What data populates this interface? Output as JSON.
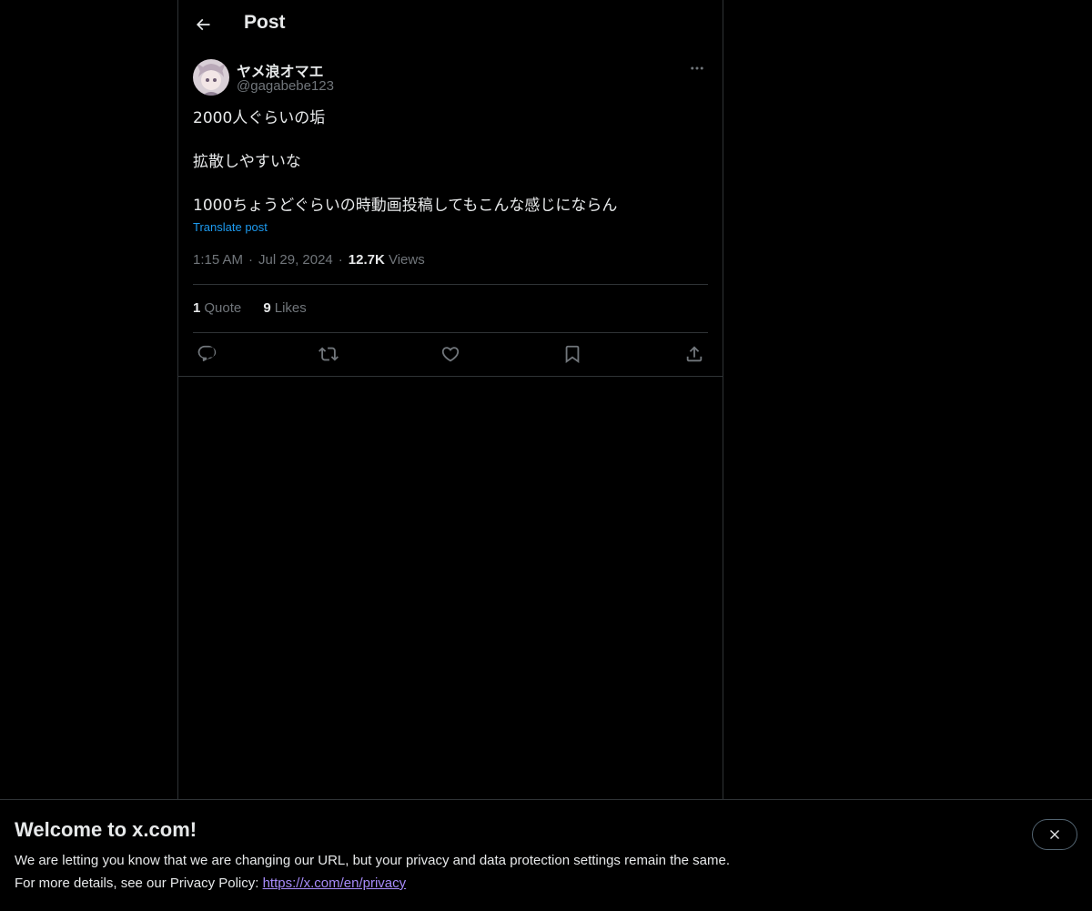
{
  "header": {
    "title": "Post",
    "back_icon": "arrow-left-icon"
  },
  "author": {
    "display_name": "ヤメ浪オマエ",
    "handle": "@gagabebe123",
    "more_icon": "more-horizontal-icon"
  },
  "tweet": {
    "text": "2000人ぐらいの垢\n\n拡散しやすいな\n\n1000ちょうどぐらいの時動画投稿してもこんな感じにならん",
    "translate_label": "Translate post",
    "time": "1:15 AM",
    "date": "Jul 29, 2024",
    "views_count": "12.7K",
    "views_label": "Views",
    "separator": "·"
  },
  "stats": {
    "quotes_count": "1",
    "quotes_label": "Quote",
    "likes_count": "9",
    "likes_label": "Likes"
  },
  "actions": [
    {
      "name": "reply-icon"
    },
    {
      "name": "retweet-icon"
    },
    {
      "name": "like-icon"
    },
    {
      "name": "bookmark-icon"
    },
    {
      "name": "share-icon"
    }
  ],
  "banner": {
    "title": "Welcome to x.com!",
    "line1": "We are letting you know that we are changing our URL, but your privacy and data protection settings remain the same.",
    "line2_prefix": "For more details, see our Privacy Policy: ",
    "link_text": "https://x.com/en/privacy",
    "close_icon": "close-icon"
  },
  "colors": {
    "background": "#000000",
    "text_primary": "#e7e9ea",
    "text_secondary": "#71767b",
    "accent": "#1d9bf0",
    "border": "#2f3336",
    "link_visited": "#a78bfa"
  }
}
